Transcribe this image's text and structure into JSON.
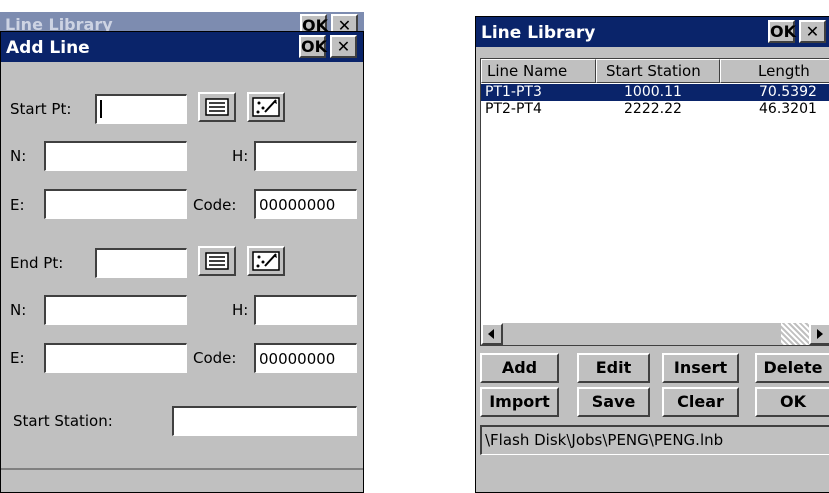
{
  "left_dialog": {
    "bg_title": "Line Library",
    "bg_ok_label": "OK",
    "bg_close_label": "✕",
    "title": "Add Line",
    "ok_label": "OK",
    "close_label": "✕",
    "start_pt_label": "Start Pt:",
    "start_pt_value": "",
    "n1_label": "N:",
    "n1_value": "",
    "h1_label": "H:",
    "h1_value": "",
    "e1_label": "E:",
    "e1_value": "",
    "code1_label": "Code:",
    "code1_value": "00000000",
    "end_pt_label": "End Pt:",
    "end_pt_value": "",
    "n2_label": "N:",
    "n2_value": "",
    "h2_label": "H:",
    "h2_value": "",
    "e2_label": "E:",
    "e2_value": "",
    "code2_label": "Code:",
    "code2_value": "00000000",
    "start_station_label": "Start Station:",
    "start_station_value": "",
    "status_text": ""
  },
  "right_dialog": {
    "title": "Line Library",
    "ok_label": "OK",
    "close_label": "✕",
    "columns": [
      "Line Name",
      "Start Station",
      "Length"
    ],
    "rows": [
      {
        "name": "PT1-PT3",
        "station": "1000.11",
        "length": "70.5392",
        "selected": true
      },
      {
        "name": "PT2-PT4",
        "station": "2222.22",
        "length": "46.3201",
        "selected": false
      }
    ],
    "buttons_row1": [
      "Add",
      "Edit",
      "Insert",
      "Delete"
    ],
    "buttons_row2": [
      "Import",
      "Save",
      "Clear",
      "OK"
    ],
    "path": "\\Flash Disk\\Jobs\\PENG\\PENG.lnb"
  },
  "icons": {
    "list": "list-icon",
    "map": "map-pick-icon"
  }
}
